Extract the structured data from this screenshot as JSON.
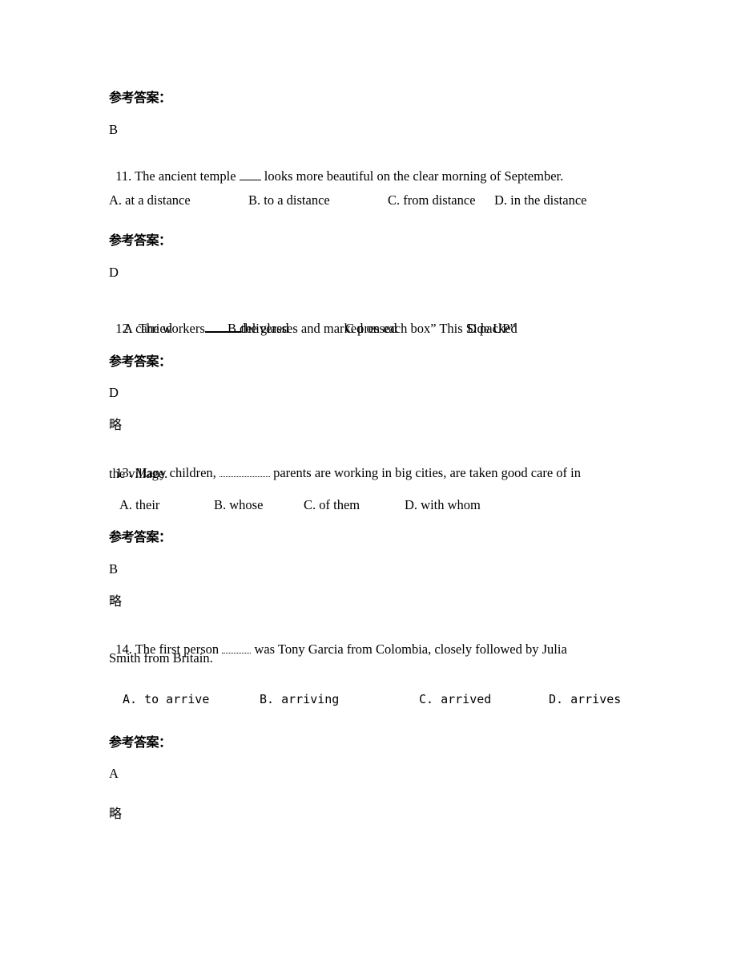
{
  "blocks": {
    "b0": {
      "label": "参考答案：",
      "answer": "B"
    },
    "q11": {
      "stem_before": "11. The ancient temple ",
      "stem_after": " looks more beautiful on the clear morning of September.",
      "options": [
        "A. at a distance",
        "B. to a distance",
        "C. from distance",
        "D. in the distance"
      ],
      "label": "参考答案：",
      "answer": "D"
    },
    "q12": {
      "stem_before": "12.  The workers",
      "stem_after": "the glasses and marked on each box” This Side UP”",
      "options": [
        "A carried",
        "B delivered",
        "C pressed",
        "D packed"
      ],
      "label": "参考答案：",
      "answer": "D",
      "note": "略"
    },
    "q13": {
      "stem_before": "13. Many children, ",
      "stem_after": " parents are working in big cities, are taken good care of in",
      "stem_line2": "the village.",
      "options": [
        "A. their",
        "B. whose",
        "C. of them",
        "D. with whom"
      ],
      "label": "参考答案：",
      "answer": "B",
      "note": "略"
    },
    "q14": {
      "stem_before": "14. The first person ",
      "stem_after": " was Tony Garcia from Colombia, closely followed by Julia",
      "stem_line2": "Smith from Britain.",
      "options": [
        "A. to arrive",
        "B. arriving",
        "C. arrived",
        "D. arrives"
      ],
      "label": "参考答案：",
      "answer": "A",
      "note": "略"
    }
  }
}
